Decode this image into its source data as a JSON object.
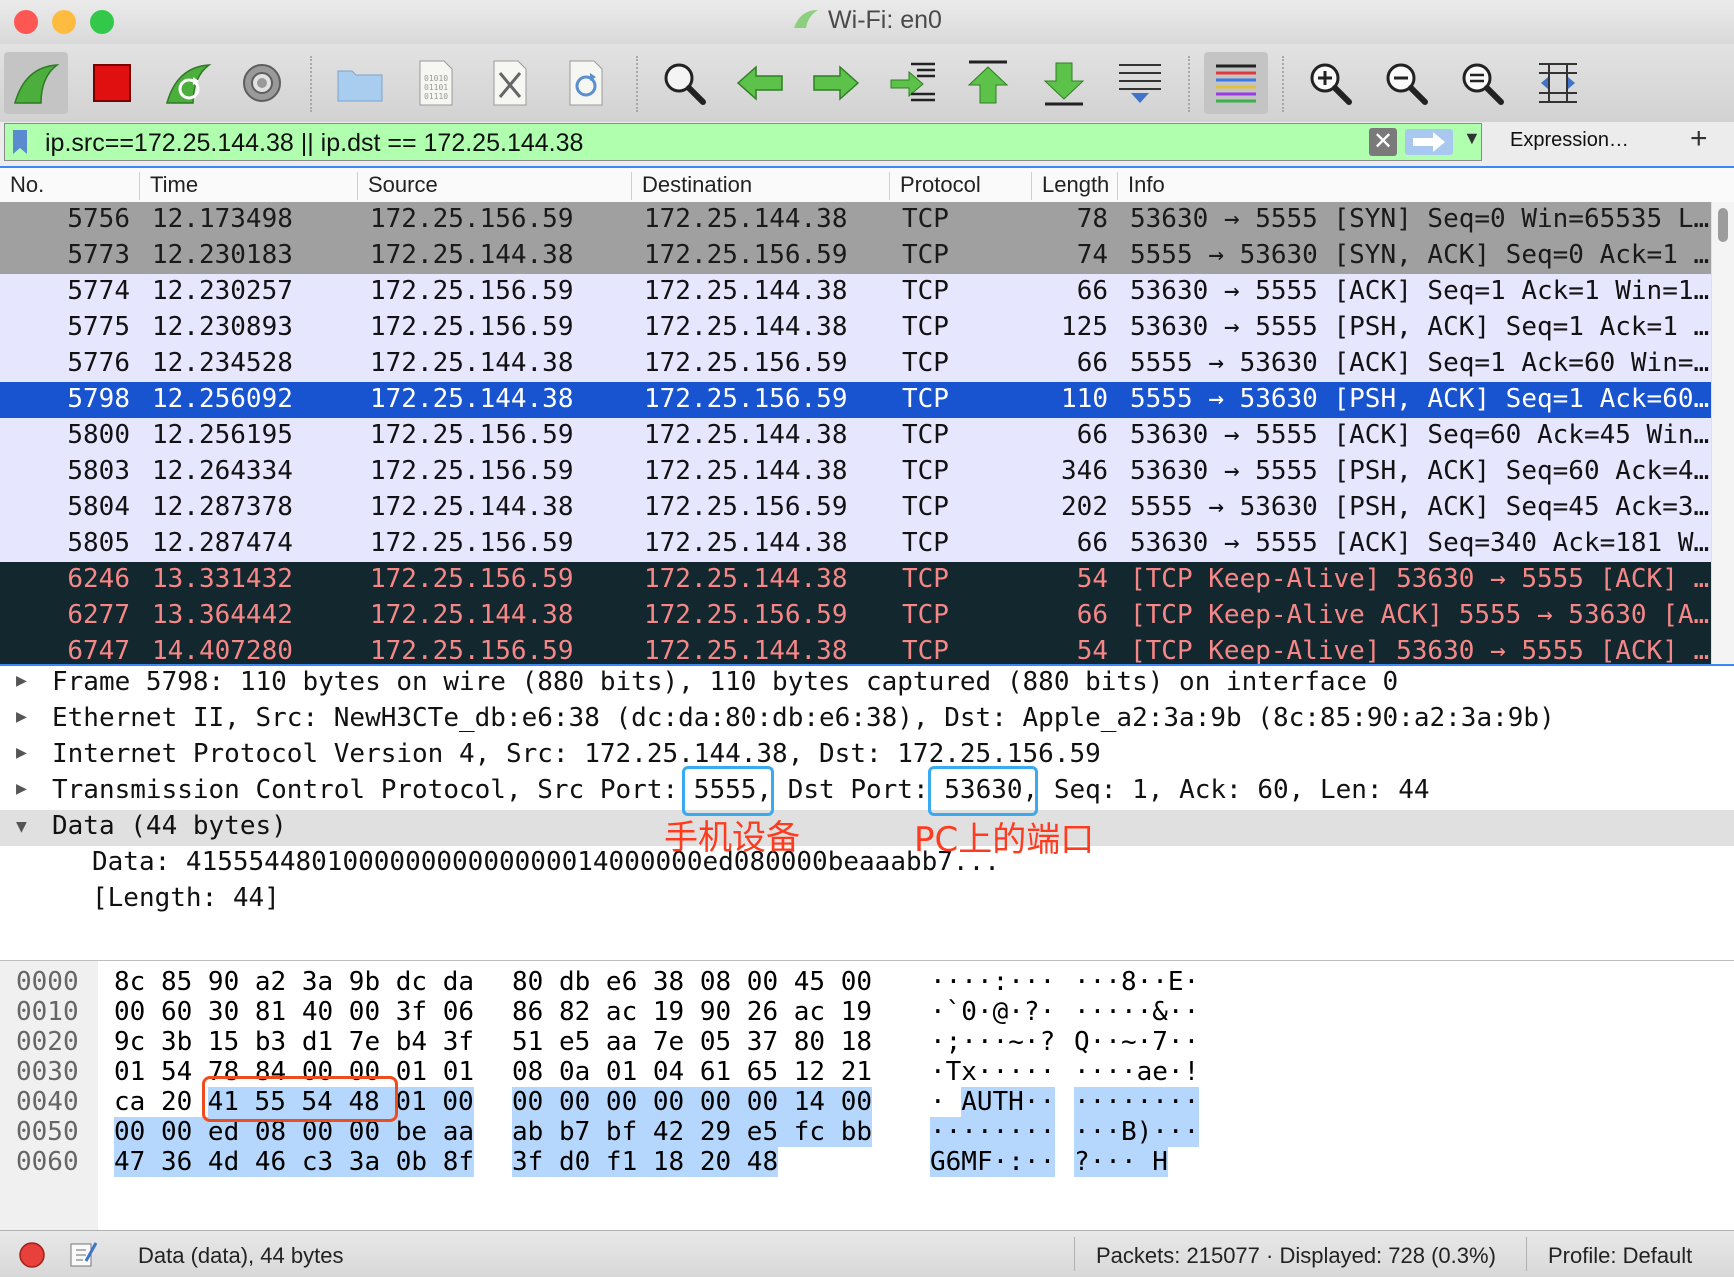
{
  "window": {
    "title": "Wi-Fi: en0",
    "traffic_lights": {
      "close": "#fc5753",
      "minimize": "#fdbc40",
      "zoom": "#34c84a"
    }
  },
  "toolbar": {
    "buttons": [
      {
        "name": "start-capture",
        "icon": "shark-fin-icon"
      },
      {
        "name": "stop-capture",
        "icon": "stop-square-icon"
      },
      {
        "name": "restart-capture",
        "icon": "restart-shark-icon"
      },
      {
        "name": "capture-options",
        "icon": "gear-icon"
      },
      {
        "name": "open-file",
        "icon": "folder-icon"
      },
      {
        "name": "save-file",
        "icon": "binary-file-icon"
      },
      {
        "name": "close-file",
        "icon": "close-file-icon"
      },
      {
        "name": "reload-file",
        "icon": "reload-file-icon"
      },
      {
        "name": "find-packet",
        "icon": "magnifier-icon"
      },
      {
        "name": "go-back",
        "icon": "arrow-left-icon"
      },
      {
        "name": "go-forward",
        "icon": "arrow-right-icon"
      },
      {
        "name": "go-to-packet",
        "icon": "go-to-packet-icon"
      },
      {
        "name": "first-packet",
        "icon": "arrow-up-first-icon"
      },
      {
        "name": "last-packet",
        "icon": "arrow-down-last-icon"
      },
      {
        "name": "auto-scroll",
        "icon": "auto-scroll-icon"
      },
      {
        "name": "colorize",
        "icon": "colorize-lines-icon"
      },
      {
        "name": "zoom-in",
        "icon": "zoom-in-icon"
      },
      {
        "name": "zoom-out",
        "icon": "zoom-out-icon"
      },
      {
        "name": "normal-size",
        "icon": "zoom-normal-icon"
      },
      {
        "name": "resize-columns",
        "icon": "resize-columns-icon"
      }
    ]
  },
  "filter": {
    "value": "ip.src==172.25.144.38 || ip.dst == 172.25.144.38",
    "clear_label": "✕",
    "expression_label": "Expression…",
    "add_label": "+",
    "bg_color": "#afffaf"
  },
  "packet_list": {
    "columns": [
      "No.",
      "Time",
      "Source",
      "Destination",
      "Protocol",
      "Length",
      "Info"
    ],
    "rows": [
      {
        "no": "5756",
        "time": "12.173498",
        "src": "172.25.156.59",
        "dst": "172.25.144.38",
        "proto": "TCP",
        "len": "78",
        "info": "53630 → 5555 [SYN] Seq=0 Win=65535 L…",
        "style": "gray"
      },
      {
        "no": "5773",
        "time": "12.230183",
        "src": "172.25.144.38",
        "dst": "172.25.156.59",
        "proto": "TCP",
        "len": "74",
        "info": "5555 → 53630 [SYN, ACK] Seq=0 Ack=1 …",
        "style": "gray"
      },
      {
        "no": "5774",
        "time": "12.230257",
        "src": "172.25.156.59",
        "dst": "172.25.144.38",
        "proto": "TCP",
        "len": "66",
        "info": "53630 → 5555 [ACK] Seq=1 Ack=1 Win=1…",
        "style": "lav"
      },
      {
        "no": "5775",
        "time": "12.230893",
        "src": "172.25.156.59",
        "dst": "172.25.144.38",
        "proto": "TCP",
        "len": "125",
        "info": "53630 → 5555 [PSH, ACK] Seq=1 Ack=1 …",
        "style": "lav"
      },
      {
        "no": "5776",
        "time": "12.234528",
        "src": "172.25.144.38",
        "dst": "172.25.156.59",
        "proto": "TCP",
        "len": "66",
        "info": "5555 → 53630 [ACK] Seq=1 Ack=60 Win=…",
        "style": "lav"
      },
      {
        "no": "5798",
        "time": "12.256092",
        "src": "172.25.144.38",
        "dst": "172.25.156.59",
        "proto": "TCP",
        "len": "110",
        "info": "5555 → 53630 [PSH, ACK] Seq=1 Ack=60…",
        "style": "sel"
      },
      {
        "no": "5800",
        "time": "12.256195",
        "src": "172.25.156.59",
        "dst": "172.25.144.38",
        "proto": "TCP",
        "len": "66",
        "info": "53630 → 5555 [ACK] Seq=60 Ack=45 Win…",
        "style": "lav"
      },
      {
        "no": "5803",
        "time": "12.264334",
        "src": "172.25.156.59",
        "dst": "172.25.144.38",
        "proto": "TCP",
        "len": "346",
        "info": "53630 → 5555 [PSH, ACK] Seq=60 Ack=4…",
        "style": "lav"
      },
      {
        "no": "5804",
        "time": "12.287378",
        "src": "172.25.144.38",
        "dst": "172.25.156.59",
        "proto": "TCP",
        "len": "202",
        "info": "5555 → 53630 [PSH, ACK] Seq=45 Ack=3…",
        "style": "lav"
      },
      {
        "no": "5805",
        "time": "12.287474",
        "src": "172.25.156.59",
        "dst": "172.25.144.38",
        "proto": "TCP",
        "len": "66",
        "info": "53630 → 5555 [ACK] Seq=340 Ack=181 W…",
        "style": "lav"
      },
      {
        "no": "6246",
        "time": "13.331432",
        "src": "172.25.156.59",
        "dst": "172.25.144.38",
        "proto": "TCP",
        "len": "54",
        "info": "[TCP Keep-Alive] 53630 → 5555 [ACK] …",
        "style": "dark"
      },
      {
        "no": "6277",
        "time": "13.364442",
        "src": "172.25.144.38",
        "dst": "172.25.156.59",
        "proto": "TCP",
        "len": "66",
        "info": "[TCP Keep-Alive ACK] 5555 → 53630 [A…",
        "style": "dark"
      },
      {
        "no": "6747",
        "time": "14.407280",
        "src": "172.25.156.59",
        "dst": "172.25.144.38",
        "proto": "TCP",
        "len": "54",
        "info": "[TCP Keep-Alive] 53630 → 5555 [ACK] …",
        "style": "dark"
      }
    ]
  },
  "details": {
    "frame": "Frame 5798: 110 bytes on wire (880 bits), 110 bytes captured (880 bits) on interface 0",
    "ethernet": "Ethernet II, Src: NewH3CTe_db:e6:38 (dc:da:80:db:e6:38), Dst: Apple_a2:3a:9b (8c:85:90:a2:3a:9b)",
    "ip": "Internet Protocol Version 4, Src: 172.25.144.38, Dst: 172.25.156.59",
    "tcp_prefix": "Transmission Control Protocol, Src Port: ",
    "tcp_src_port": "5555,",
    "tcp_mid": " Dst Port: ",
    "tcp_dst_port": "53630,",
    "tcp_suffix": " Seq: 1, Ack: 60, Len: 44",
    "data_header": "Data (44 bytes)",
    "data_value": "Data: 415554480100000000000000014000000ed080000beaaabb7...",
    "data_length": "[Length: 44]",
    "annotation_device": "手机设备",
    "annotation_pc": "PC上的端口"
  },
  "bytes": {
    "lines": [
      {
        "offset": "0000",
        "hex1": "8c 85 90 a2 3a 9b dc da",
        "hex2": "80 db e6 38 08 00 45 00",
        "ascii1": "····:···",
        "ascii2": "···8··E·"
      },
      {
        "offset": "0010",
        "hex1": "00 60 30 81 40 00 3f 06",
        "hex2": "86 82 ac 19 90 26 ac 19",
        "ascii1": "·`0·@·?·",
        "ascii2": "·····&··"
      },
      {
        "offset": "0020",
        "hex1": "9c 3b 15 b3 d1 7e b4 3f",
        "hex2": "51 e5 aa 7e 05 37 80 18",
        "ascii1": "·;···~·?",
        "ascii2": "Q··~·7··"
      },
      {
        "offset": "0030",
        "hex1": "01 54 78 84 00 00 01 01",
        "hex2": "08 0a 01 04 61 65 12 21",
        "ascii1": "·Tx·····",
        "ascii2": "····ae·!"
      },
      {
        "offset": "0040",
        "hex1a": "ca 20 ",
        "hex1b": "41 55 54 48 01 00",
        "hex2": "00 00 00 00 00 00 14 00",
        "ascii1a": "· ",
        "ascii1b": "AUTH··",
        "ascii2": "········"
      },
      {
        "offset": "0050",
        "hex1": "00 00 ed 08 00 00 be aa",
        "hex2": "ab b7 bf 42 29 e5 fc bb",
        "ascii1": "········",
        "ascii2": "···B)···"
      },
      {
        "offset": "0060",
        "hex1": "47 36 4d 46 c3 3a 0b 8f",
        "hex2": "3f d0 f1 18 20 48",
        "ascii1": "G6MF·:··",
        "ascii2": "?··· H"
      }
    ]
  },
  "status": {
    "field_info": "Data (data), 44 bytes",
    "packets": "Packets: 215077 · Displayed: 728 (0.3%)",
    "profile": "Profile: Default"
  }
}
